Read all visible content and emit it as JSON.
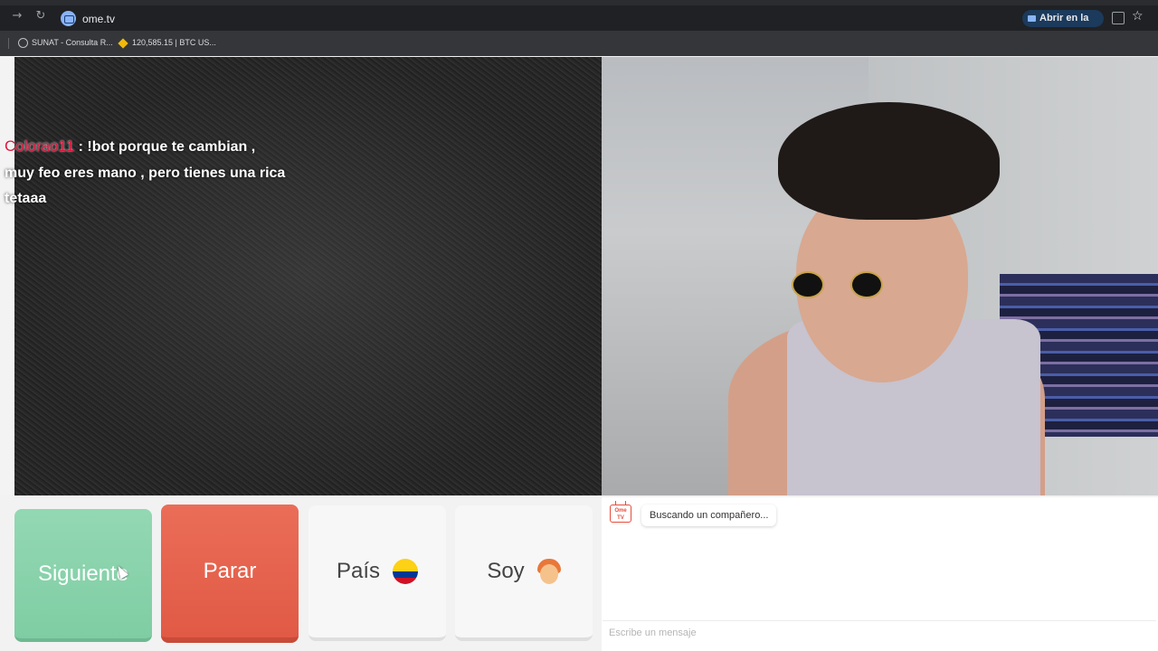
{
  "browser": {
    "url": "ome.tv",
    "open_in_app_label": "Abrir en la app",
    "bookmarks": [
      {
        "label": "SUNAT - Consulta R...",
        "icon": "globe-icon"
      },
      {
        "label": "120,585.15 | BTC US...",
        "icon": "binance-icon"
      }
    ]
  },
  "stranger_chat": {
    "username": "Colorao11",
    "message_line1": " : !bot porque te cambian ,",
    "message_line2": "muy feo eres mano , pero tienes una rica",
    "message_line3": "tetaaa"
  },
  "controls": {
    "next_label": "Siguiente",
    "stop_label": "Parar",
    "country_label": "País",
    "country_flag": "colombia-flag-icon",
    "gender_label": "Soy",
    "gender_icon": "boy-face-icon"
  },
  "chat_panel": {
    "logo_text": "Ome TV",
    "status_message": "Buscando un compañero...",
    "input_placeholder": "Escribe un mensaje"
  },
  "colors": {
    "next": "#8fd5b0",
    "stop": "#e5624d",
    "neutral_button": "#f7f7f7"
  }
}
